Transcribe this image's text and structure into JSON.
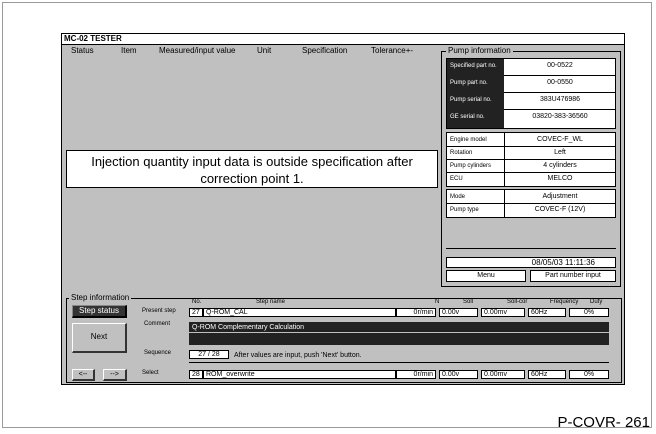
{
  "window": {
    "title": "MC-02 TESTER"
  },
  "header": {
    "columns": [
      "Status",
      "Item",
      "Measured/input value",
      "Unit",
      "Specification",
      "Tolerance+-"
    ]
  },
  "message": "Injection quantity input data is outside specification after correction point 1.",
  "pump_info": {
    "title": "Pump information",
    "group1": [
      {
        "label": "Specified part no.",
        "value": "00-0522"
      },
      {
        "label": "Pump part no.",
        "value": "00-0550"
      },
      {
        "label": "Pump serial no.",
        "value": "383U476986"
      },
      {
        "label": "GE serial no.",
        "value": "03820-383-36560"
      }
    ],
    "group2": [
      {
        "label": "Engine model",
        "value": "COVEC-F_WL"
      },
      {
        "label": "Rotation",
        "value": "Left"
      },
      {
        "label": "Pump cylinders",
        "value": "4 cylinders"
      },
      {
        "label": "ECU",
        "value": "MELCO"
      }
    ],
    "group3": [
      {
        "label": "Mode",
        "value": "Adjustment"
      },
      {
        "label": "Pump type",
        "value": "COVEC-F (12V)"
      }
    ],
    "datetime": "08/05/03  11:11:36",
    "menu_label": "Menu",
    "part_number_label": "Part number input"
  },
  "step_info": {
    "title": "Step information",
    "columns": {
      "no": "No.",
      "name": "Step name",
      "n": "N",
      "soll": "Soll",
      "soll_cor": "Soll-cor",
      "freq": "Frequency",
      "duty": "Duty"
    },
    "present_label": "Present step",
    "present": {
      "no": "27",
      "name": "Q-ROM_CAL",
      "n": "0r/min",
      "soll": "0.00v",
      "soll_cor": "0.00mv",
      "freq": "60Hz",
      "duty": "0%"
    },
    "comment_label": "Comment",
    "comment": "Q-ROM Complementary Calculation",
    "sequence_label": "Sequence",
    "sequence": "27 / 28",
    "hint": "After values are input, push 'Next' button.",
    "select_label": "Select",
    "select": {
      "no": "28",
      "name": "ROM_overwrite",
      "n": "0r/min",
      "soll": "0.00v",
      "soll_cor": "0.00mv",
      "freq": "60Hz",
      "duty": "0%"
    },
    "status_button": "Step status",
    "next_button": "Next",
    "prev_button": "<--",
    "fwd_button": "-->"
  },
  "footer": {
    "code": "P-COVR- 261"
  }
}
